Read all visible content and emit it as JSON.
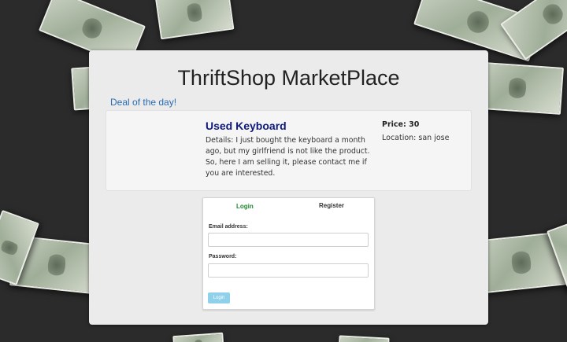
{
  "header": {
    "site_title": "ThriftShop MarketPlace",
    "deal_link": "Deal of the day!"
  },
  "listing": {
    "title": "Used Keyboard",
    "details": "Details: I just bought the keyboard a month ago, but my girlfriend is not like the product. So, here I am selling it, please contact me if you are interested.",
    "price": "Price: 30",
    "location": "Location: san jose"
  },
  "auth": {
    "tabs": {
      "login": "Login",
      "register": "Register"
    },
    "email_label": "Email address:",
    "email_value": "",
    "password_label": "Password:",
    "password_value": "",
    "login_button": "Login"
  },
  "colors": {
    "page_background": "#2b2b2b",
    "panel_background": "#ebebeb",
    "deal_link": "#2a6cb0",
    "item_title": "#0d1a7a",
    "active_tab": "#1f8a2e",
    "login_button": "#8fd0ea"
  }
}
